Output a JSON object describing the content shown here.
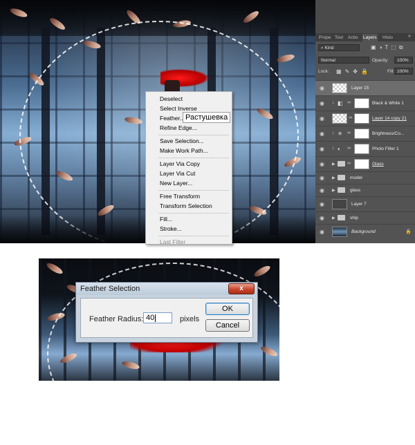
{
  "context_menu": {
    "items": [
      "Deselect",
      "Select Inverse",
      "Feather...",
      "Refine Edge...",
      "Save Selection...",
      "Make Work Path...",
      "Layer Via Copy",
      "Layer Via Cut",
      "New Layer...",
      "Free Transform",
      "Transform Selection",
      "Fill...",
      "Stroke...",
      "Last Filter"
    ],
    "disabled_item": "Last Filter",
    "tooltip": "Растушевка"
  },
  "panel": {
    "tabs": [
      "Prope",
      "Tool",
      "Actio",
      "Layers",
      "Histo"
    ],
    "active_tab": "Layers",
    "tab_menu_icon": "»",
    "filter_kind": "Kind",
    "blend_mode": "Normal",
    "opacity_label": "Opacity:",
    "opacity_value": "100%",
    "lock_label": "Lock:",
    "fill_label": "Fill:",
    "fill_value": "100%",
    "layers": [
      {
        "name": "Layer 15",
        "selected": true
      },
      {
        "name": "Black & White 1"
      },
      {
        "name": "Layer 14 copy 21"
      },
      {
        "name": "Brightness/Co..."
      },
      {
        "name": "Photo Filter 1"
      },
      {
        "name": "Glass"
      },
      {
        "name": "model"
      },
      {
        "name": "glass"
      },
      {
        "name": "Layer 7"
      },
      {
        "name": "ship"
      },
      {
        "name": "Background"
      }
    ]
  },
  "dialog": {
    "title": "Feather Selection",
    "close_icon": "x",
    "field_label": "Feather Radius:",
    "value": "40",
    "unit": "pixels",
    "ok_label": "OK",
    "cancel_label": "Cancel"
  },
  "colors": {
    "selection_accent": "#ff0000",
    "panel_bg": "#535353",
    "menu_bg": "#f0f0f0",
    "dialog_frame": "#c8d3df",
    "close_button": "#c9452c"
  }
}
